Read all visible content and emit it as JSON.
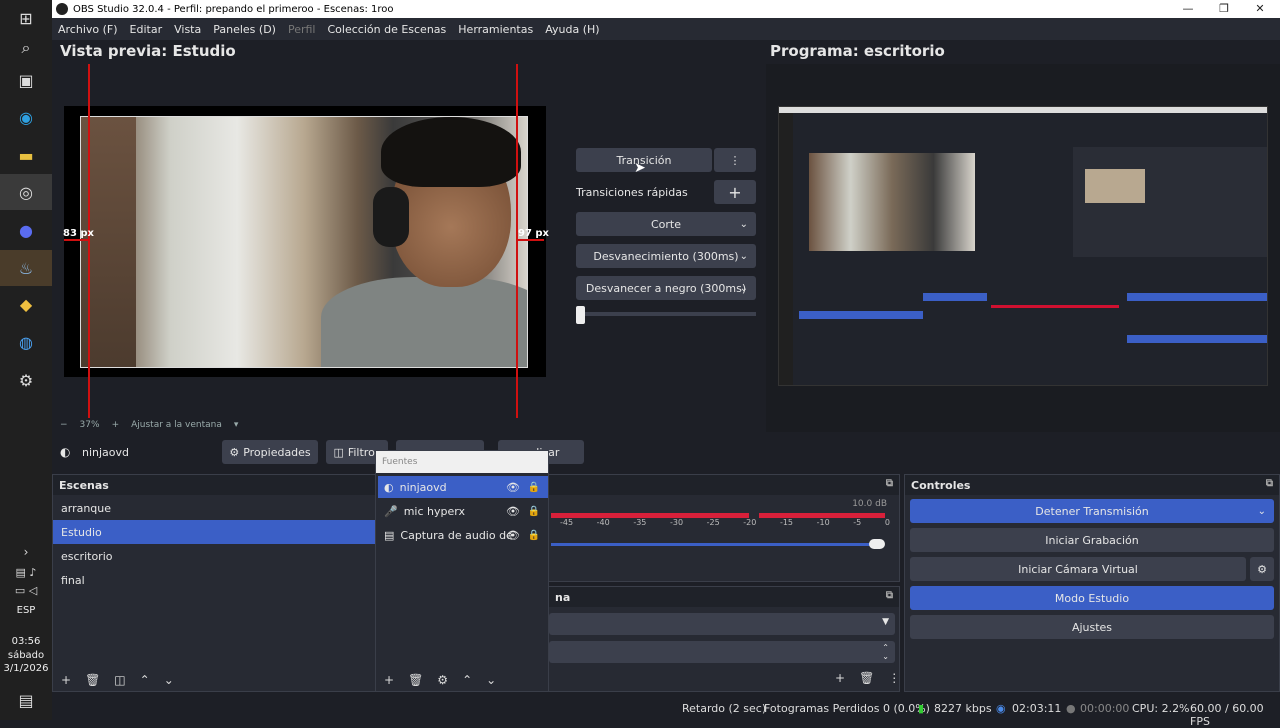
{
  "taskbar": {
    "lang": "ESP",
    "time": "03:56",
    "day": "sábado",
    "date": "3/1/2026"
  },
  "window": {
    "title": "OBS Studio 32.0.4 - Perfil: prepando el primeroo - Escenas: 1roo",
    "minimize": "—",
    "maximize": "❐",
    "close": "✕"
  },
  "menu": {
    "archivo": "Archivo (F)",
    "editar": "Editar",
    "vista": "Vista",
    "paneles": "Paneles (D)",
    "perfil": "Perfil",
    "coleccion": "Colección de Escenas",
    "herramientas": "Herramientas",
    "ayuda": "Ayuda (H)"
  },
  "preview": {
    "title": "Vista previa: Estudio",
    "left_px": "83 px",
    "right_px": "97 px",
    "zoom_minus": "−",
    "zoom_value": "37%",
    "zoom_plus": "+",
    "fit": "Ajustar a la ventana"
  },
  "program": {
    "title": "Programa: escritorio"
  },
  "transitions": {
    "transition_button": "Transición",
    "quick_label": "Transiciones rápidas",
    "items": [
      "Corte",
      "Desvanecimiento (300ms)",
      "Desvanecer a negro (300ms)"
    ]
  },
  "sourcebar": {
    "name": "ninjaovd",
    "properties": "Propiedades",
    "filters": "Filtros",
    "interact": "ualizar"
  },
  "scenes": {
    "title": "Escenas",
    "items": [
      "arranque",
      "Estudio",
      "escritorio",
      "final"
    ],
    "active_index": 1
  },
  "sources_popup": {
    "title": "Fuentes",
    "items": [
      "ninjaovd",
      "mic hyperx",
      "Captura de audio de"
    ]
  },
  "mixer": {
    "db_top": "10.0 dB",
    "scale": [
      "-45",
      "-40",
      "-35",
      "-30",
      "-25",
      "-20",
      "-15",
      "-10",
      "-5",
      "0"
    ],
    "dock_fragment": "na"
  },
  "controls": {
    "title": "Controles",
    "stop_stream": "Detener Transmisión",
    "start_record": "Iniciar Grabación",
    "virtual_cam": "Iniciar Cámara Virtual",
    "studio_mode": "Modo Estudio",
    "settings": "Ajustes"
  },
  "status": {
    "delay": "Retardo (2 sec)",
    "dropped": "Fotogramas Perdidos 0 (0.0%)",
    "bitrate": "8227 kbps",
    "stream_time": "02:03:11",
    "rec_time": "00:00:00",
    "cpu": "CPU: 2.2%",
    "fps": "60.00 / 60.00 FPS"
  },
  "colors": {
    "accent": "#3b5fc6",
    "background": "#1d1f26",
    "guide": "#d01010"
  }
}
